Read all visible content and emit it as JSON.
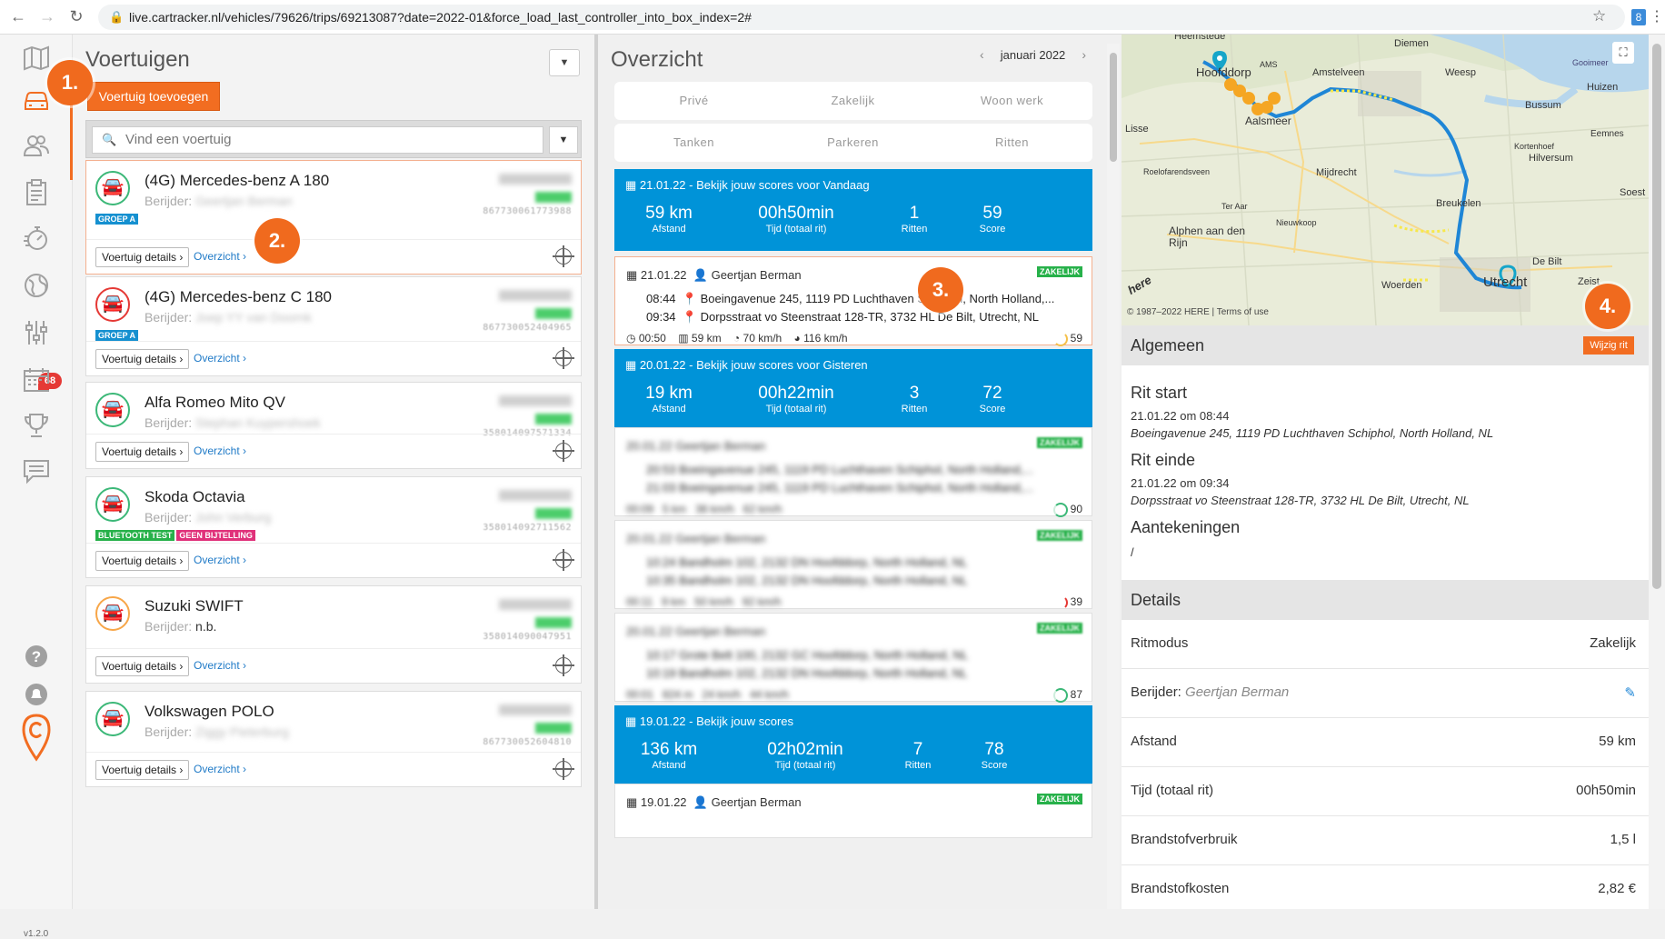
{
  "browser": {
    "url": "live.cartracker.nl/vehicles/79626/trips/69213087?date=2022-01&force_load_last_controller_into_box_index=2#",
    "extension_badge": "8"
  },
  "sidebar": {
    "badge": "68",
    "version": "v1.2.0",
    "icons": [
      "map-icon",
      "car-icon",
      "users-icon",
      "clipboard-icon",
      "stopwatch-icon",
      "globe-icon",
      "sliders-icon",
      "calendar-car-icon",
      "trophy-icon",
      "chat-icon",
      "help-icon",
      "bell-icon",
      "cartracker-logo"
    ]
  },
  "vehicles": {
    "title": "Voertuigen",
    "add_button": "Voertuig toevoegen",
    "search_placeholder": "Vind een voertuig",
    "details_label": "Voertuig details ›",
    "overview_label": "Overzicht ›",
    "items": [
      {
        "name": "(4G) Mercedes-benz A 180",
        "driver_label": "Berijder:",
        "driver": "Geertjan Berman",
        "imei": "867730061773988",
        "tags": [
          "GROEP A"
        ]
      },
      {
        "name": "(4G) Mercedes-benz C 180",
        "driver_label": "Berijder:",
        "driver": "Joep YY van Doornk",
        "imei": "867730052404965",
        "tags": [
          "GROEP A"
        ]
      },
      {
        "name": "Alfa Romeo Mito QV",
        "driver_label": "Berijder:",
        "driver": "Stephan Kuypershoek",
        "imei": "358014097571334",
        "tags": []
      },
      {
        "name": "Skoda Octavia",
        "driver_label": "Berijder:",
        "driver": "John Verburg",
        "imei": "358014092711562",
        "tags": [
          "BLUETOOTH TEST",
          "GEEN BIJTELLING"
        ]
      },
      {
        "name": "Suzuki SWIFT",
        "driver_label": "Berijder:",
        "driver": "n.b.",
        "imei": "358014090047951",
        "tags": []
      },
      {
        "name": "Volkswagen POLO",
        "driver_label": "Berijder:",
        "driver": "Ziggy Pieterburg",
        "imei": "867730052604810",
        "tags": []
      }
    ]
  },
  "callouts": [
    "1.",
    "2.",
    "3.",
    "4."
  ],
  "overview": {
    "title": "Overzicht",
    "month": "januari 2022",
    "tabs_row1": [
      "Privé",
      "Zakelijk",
      "Woon werk"
    ],
    "tabs_row2": [
      "Tanken",
      "Parkeren",
      "Ritten"
    ],
    "days": [
      {
        "title": "21.01.22 - Bekijk jouw scores voor Vandaag",
        "distance": "59 km",
        "time": "00h50min",
        "trips": "1",
        "score": "59"
      },
      {
        "title": "20.01.22 - Bekijk jouw scores voor Gisteren",
        "distance": "19 km",
        "time": "00h22min",
        "trips": "3",
        "score": "72"
      },
      {
        "title": "19.01.22 - Bekijk jouw scores",
        "distance": "136 km",
        "time": "02h02min",
        "trips": "7",
        "score": "78"
      }
    ],
    "stat_labels": {
      "distance": "Afstand",
      "time": "Tijd (totaal rit)",
      "trips": "Ritten",
      "score": "Score"
    },
    "trips": [
      {
        "date": "21.01.22",
        "driver": "Geertjan Berman",
        "badge": "ZAKELIJK",
        "t1": "08:44",
        "a1": "Boeingavenue 245, 1119 PD Luchthaven Schiphol, North Holland,...",
        "t2": "09:34",
        "a2": "Dorpsstraat vo Steenstraat 128-TR, 3732 HL De Bilt, Utrecht, NL",
        "duration": "00:50",
        "dist": "59 km",
        "avg": "70 km/h",
        "max": "116 km/h",
        "score": "59"
      },
      {
        "date": "20.01.22",
        "driver": "Geertjan Berman",
        "badge": "ZAKELIJK",
        "t1": "20:53",
        "a1": "Boeingavenue 245, 1119 PD Luchthaven Schiphol, North Holland,...",
        "t2": "21:03",
        "a2": "Boeingavenue 245, 1119 PD Luchthaven Schiphol, North Holland,...",
        "duration": "00:09",
        "dist": "5 km",
        "avg": "38 km/h",
        "max": "62 km/h",
        "score": "90"
      },
      {
        "date": "20.01.22",
        "driver": "Geertjan Berman",
        "badge": "ZAKELIJK",
        "t1": "10:24",
        "a1": "Bandholm 102, 2132 DN Hoofddorp, North Holland, NL",
        "t2": "10:35",
        "a2": "Bandholm 102, 2132 DN Hoofddorp, North Holland, NL",
        "duration": "00:11",
        "dist": "9 km",
        "avg": "50 km/h",
        "max": "92 km/h",
        "score": "39"
      },
      {
        "date": "20.01.22",
        "driver": "Geertjan Berman",
        "badge": "ZAKELIJK",
        "t1": "10:17",
        "a1": "Grote Belt 100, 2132 GC Hoofddorp, North Holland, NL",
        "t2": "10:19",
        "a2": "Bandholm 102, 2132 DN Hoofddorp, North Holland, NL",
        "duration": "00:01",
        "dist": "824 m",
        "avg": "24 km/h",
        "max": "44 km/h",
        "score": "87"
      },
      {
        "date": "19.01.22",
        "driver": "Geertjan Berman",
        "badge": "ZAKELIJK"
      }
    ]
  },
  "map": {
    "labels": [
      "Heemstede",
      "Diemen",
      "Hoofddorp",
      "AMS",
      "Amstelveen",
      "Weesp",
      "Gooimeer",
      "Huizen",
      "Bussum",
      "Aalsmeer",
      "Lisse",
      "Kortenhoef",
      "Eemnes",
      "Hilversum",
      "Roelofarendsveen",
      "Mijdrecht",
      "Soest",
      "Ter Aar",
      "Breukelen",
      "Nieuwkoop",
      "Alphen aan den Rijn",
      "Woerden",
      "Utrecht",
      "De Bilt",
      "Zeist"
    ],
    "copyright": "© 1987–2022 HERE | Terms of use",
    "here_logo": "here"
  },
  "detail": {
    "edit_button": "Wijzig rit",
    "general_header": "Algemeen",
    "start_label": "Rit start",
    "start_time": "21.01.22 om 08:44",
    "start_address": "Boeingavenue 245, 1119 PD Luchthaven Schiphol, North Holland, NL",
    "end_label": "Rit einde",
    "end_time": "21.01.22 om 09:34",
    "end_address": "Dorpsstraat vo Steenstraat 128-TR, 3732 HL De Bilt, Utrecht, NL",
    "notes_label": "Aantekeningen",
    "notes_value": "/",
    "details_header": "Details",
    "rows": [
      {
        "key": "Ritmodus",
        "value": "Zakelijk"
      },
      {
        "key": "Berijder:",
        "key_extra": "Geertjan Berman",
        "value": ""
      },
      {
        "key": "Afstand",
        "value": "59 km"
      },
      {
        "key": "Tijd (totaal rit)",
        "value": "00h50min"
      },
      {
        "key": "Brandstofverbruik",
        "value": "1,5 l"
      },
      {
        "key": "Brandstofkosten",
        "value": "2,82 €"
      }
    ]
  },
  "colors": {
    "accent": "#f26d21",
    "blue": "#0093d8",
    "green": "#27b14a"
  }
}
